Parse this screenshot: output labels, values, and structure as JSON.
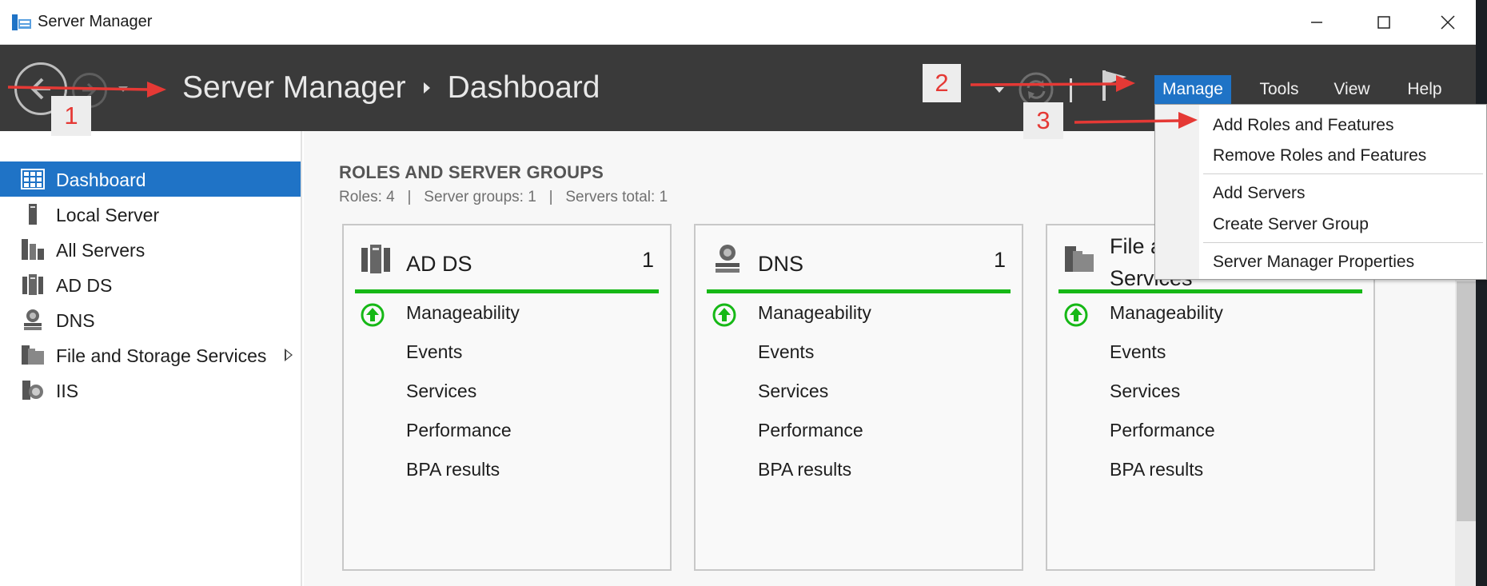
{
  "window": {
    "title": "Server Manager"
  },
  "header": {
    "breadcrumb_app": "Server Manager",
    "breadcrumb_page": "Dashboard",
    "menus": [
      "Manage",
      "Tools",
      "View",
      "Help"
    ],
    "active_menu": "Manage"
  },
  "annotations": [
    "1",
    "2",
    "3"
  ],
  "sidebar": {
    "items": [
      {
        "label": "Dashboard",
        "icon": "dashboard-icon",
        "active": true
      },
      {
        "label": "Local Server",
        "icon": "server-icon"
      },
      {
        "label": "All Servers",
        "icon": "servers-icon"
      },
      {
        "label": "AD DS",
        "icon": "ad-ds-icon"
      },
      {
        "label": "DNS",
        "icon": "dns-icon"
      },
      {
        "label": "File and Storage Services",
        "icon": "file-storage-icon",
        "has_submenu": true
      },
      {
        "label": "IIS",
        "icon": "iis-icon"
      }
    ]
  },
  "main": {
    "section_title": "ROLES AND SERVER GROUPS",
    "section_sub": "Roles: 4   |   Server groups: 1   |   Servers total: 1",
    "cards": [
      {
        "title": "AD DS",
        "count": "1",
        "icon": "ad-ds-icon",
        "rows": [
          "Manageability",
          "Events",
          "Services",
          "Performance",
          "BPA results"
        ]
      },
      {
        "title": "DNS",
        "count": "1",
        "icon": "dns-icon",
        "rows": [
          "Manageability",
          "Events",
          "Services",
          "Performance",
          "BPA results"
        ]
      },
      {
        "title_line1": "File a",
        "title_line2": "Services",
        "icon": "file-storage-icon",
        "rows": [
          "Manageability",
          "Events",
          "Services",
          "Performance",
          "BPA results"
        ]
      }
    ]
  },
  "manage_menu": {
    "items": [
      "Add Roles and Features",
      "Remove Roles and Features",
      "Add Servers",
      "Create Server Group",
      "Server Manager Properties"
    ]
  },
  "colors": {
    "accent": "#1f73c6",
    "header_bg": "#3a3a3a",
    "status_green": "#16b816",
    "annotation_red": "#e53935"
  }
}
